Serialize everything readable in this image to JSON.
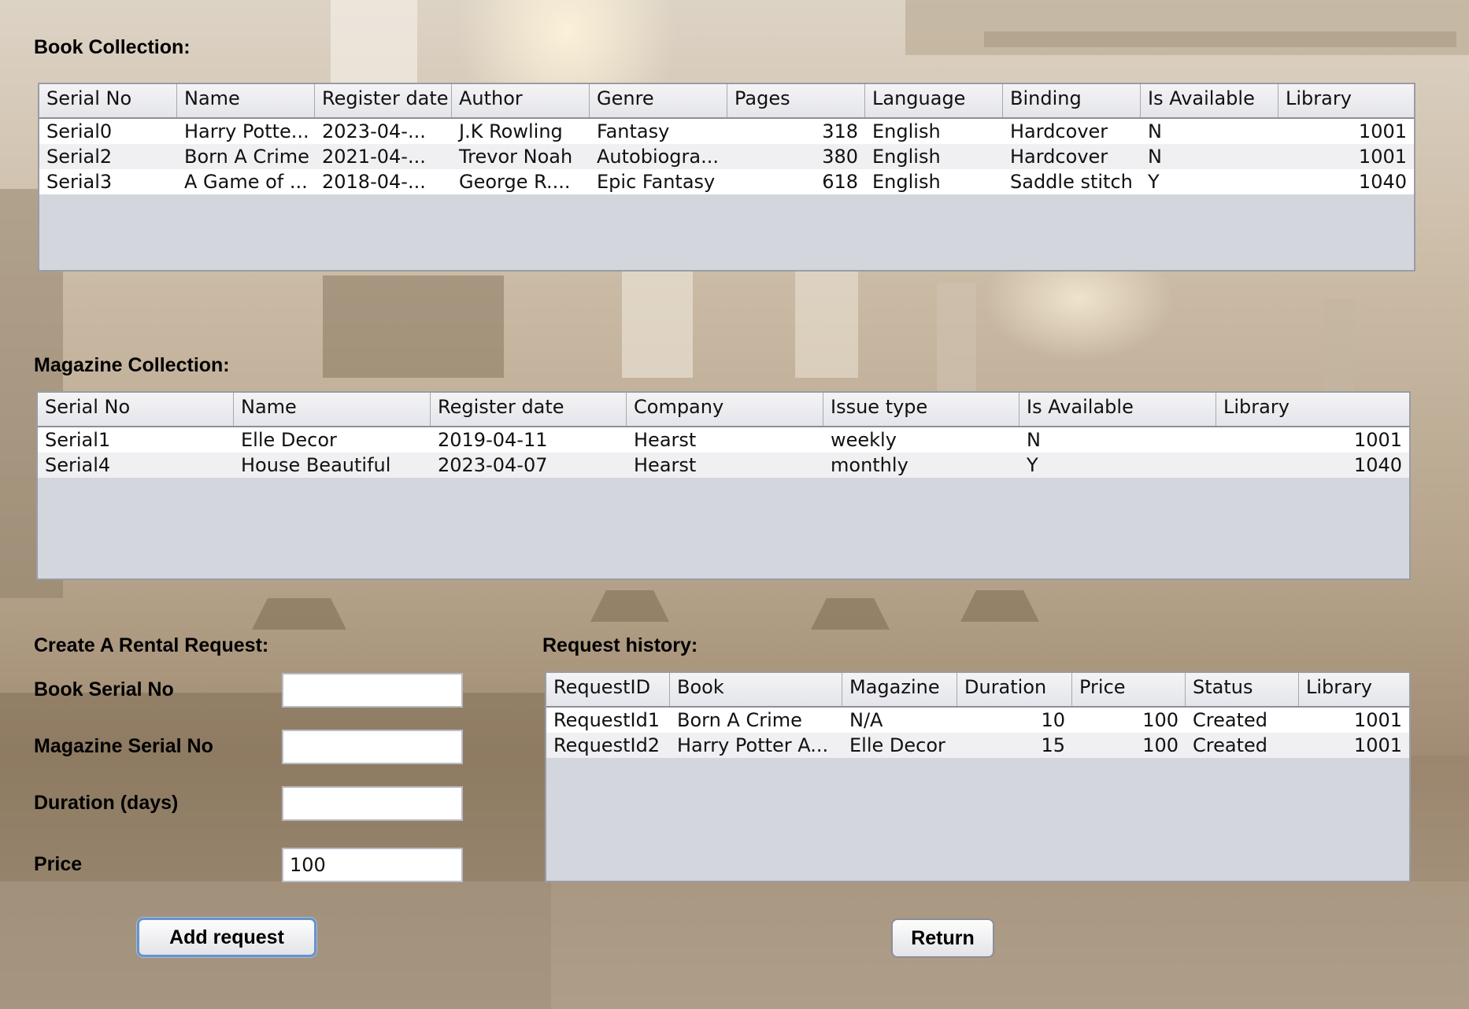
{
  "book_section": {
    "title": "Book Collection:",
    "columns": [
      "Serial No",
      "Name",
      "Register date",
      "Author",
      "Genre",
      "Pages",
      "Language",
      "Binding",
      "Is Available",
      "Library"
    ],
    "rows": [
      [
        "Serial0",
        "Harry Potte...",
        "2023-04-...",
        "J.K Rowling",
        "Fantasy",
        "318",
        "English",
        "Hardcover",
        "N",
        "1001"
      ],
      [
        "Serial2",
        "Born A Crime",
        "2021-04-...",
        "Trevor Noah",
        "Autobiogra...",
        "380",
        "English",
        "Hardcover",
        "N",
        "1001"
      ],
      [
        "Serial3",
        "A Game of ...",
        "2018-04-...",
        "George R....",
        "Epic Fantasy",
        "618",
        "English",
        "Saddle stitch",
        "Y",
        "1040"
      ]
    ]
  },
  "magazine_section": {
    "title": "Magazine Collection:",
    "columns": [
      "Serial No",
      "Name",
      "Register date",
      "Company",
      "Issue type",
      "Is Available",
      "Library"
    ],
    "rows": [
      [
        "Serial1",
        "Elle Decor",
        "2019-04-11",
        "Hearst",
        "weekly",
        "N",
        "1001"
      ],
      [
        "Serial4",
        "House Beautiful",
        "2023-04-07",
        "Hearst",
        "monthly",
        "Y",
        "1040"
      ]
    ]
  },
  "rental_form": {
    "title": "Create A Rental Request:",
    "book_serial_label": "Book Serial No",
    "book_serial_value": "",
    "magazine_serial_label": "Magazine Serial No",
    "magazine_serial_value": "",
    "duration_label": "Duration (days)",
    "duration_value": "",
    "price_label": "Price",
    "price_value": "100",
    "add_button": "Add request"
  },
  "history_section": {
    "title": "Request history:",
    "columns": [
      "RequestID",
      "Book",
      "Magazine",
      "Duration",
      "Price",
      "Status",
      "Library"
    ],
    "rows": [
      [
        "RequestId1",
        "Born A Crime",
        "N/A",
        "10",
        "100",
        "Created",
        "1001"
      ],
      [
        "RequestId2",
        "Harry Potter A...",
        "Elle Decor",
        "15",
        "100",
        "Created",
        "1001"
      ]
    ]
  },
  "return_button": "Return"
}
